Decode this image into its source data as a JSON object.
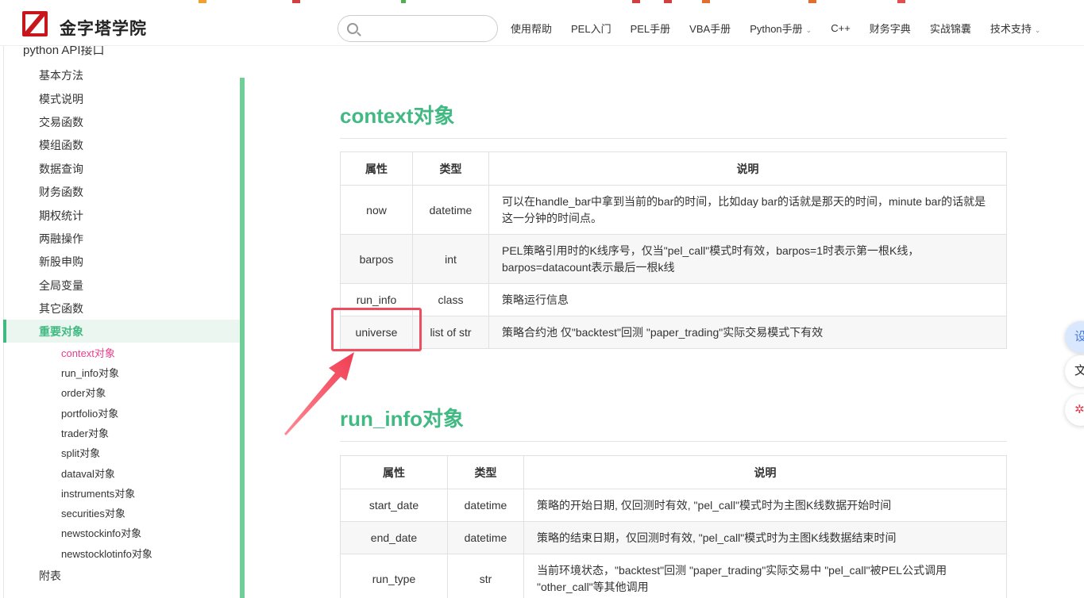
{
  "header": {
    "site_title": "金字塔学院",
    "search": {
      "placeholder": "",
      "value": ""
    },
    "nav": [
      {
        "label": "使用帮助",
        "has_dropdown": false
      },
      {
        "label": "PEL入门",
        "has_dropdown": false
      },
      {
        "label": "PEL手册",
        "has_dropdown": false
      },
      {
        "label": "VBA手册",
        "has_dropdown": false
      },
      {
        "label": "Python手册",
        "has_dropdown": true
      },
      {
        "label": "C++",
        "has_dropdown": false
      },
      {
        "label": "财务字典",
        "has_dropdown": false
      },
      {
        "label": "实战锦囊",
        "has_dropdown": false
      },
      {
        "label": "技术支持",
        "has_dropdown": true
      }
    ]
  },
  "sidebar": {
    "section": "python API接口",
    "items": [
      "基本方法",
      "模式说明",
      "交易函数",
      "模组函数",
      "数据查询",
      "财务函数",
      "期权统计",
      "两融操作",
      "新股申购",
      "全局变量",
      "其它函数",
      "重要对象"
    ],
    "active_item": "重要对象",
    "sub_items": [
      "context对象",
      "run_info对象",
      "order对象",
      "portfolio对象",
      "trader对象",
      "split对象",
      "dataval对象",
      "instruments对象",
      "securities对象",
      "newstockinfo对象",
      "newstocklotinfo对象"
    ],
    "active_sub_item": "context对象",
    "after_items": [
      "附表"
    ]
  },
  "content": {
    "sections": [
      {
        "title": "context对象",
        "headers": [
          "属性",
          "类型",
          "说明"
        ],
        "rows": [
          [
            "now",
            "datetime",
            "可以在handle_bar中拿到当前的bar的时间，比如day bar的话就是那天的时间，minute bar的话就是这一分钟的时间点。"
          ],
          [
            "barpos",
            "int",
            "PEL策略引用时的K线序号，仅当\"pel_call\"模式时有效，barpos=1时表示第一根K线，barpos=datacount表示最后一根k线"
          ],
          [
            "run_info",
            "class",
            "策略运行信息"
          ],
          [
            "universe",
            "list of str",
            "策略合约池 仅\"backtest\"回测 \"paper_trading\"实际交易模式下有效"
          ]
        ]
      },
      {
        "title": "run_info对象",
        "headers": [
          "属性",
          "类型",
          "说明"
        ],
        "rows": [
          [
            "start_date",
            "datetime",
            "策略的开始日期, 仅回测时有效, \"pel_call\"模式时为主图K线数据开始时间"
          ],
          [
            "end_date",
            "datetime",
            "策略的结束日期，仅回测时有效, \"pel_call\"模式时为主图K线数据结束时间"
          ],
          [
            "run_type",
            "str",
            "当前环境状态，\"backtest\"回测 \"paper_trading\"实际交易中 \"pel_call\"被PEL公式调用 \"other_call\"等其他调用"
          ]
        ]
      }
    ]
  },
  "floating_buttons": [
    {
      "label": "设",
      "icon": "settings-icon"
    },
    {
      "label": "文",
      "icon": "text-icon"
    },
    {
      "label": "",
      "icon": "share-icon"
    }
  ],
  "colors": {
    "accent": "#42b983",
    "active_sub": "#e83e8c",
    "highlight": "#ef4d5e",
    "logo": "#c8161d"
  }
}
